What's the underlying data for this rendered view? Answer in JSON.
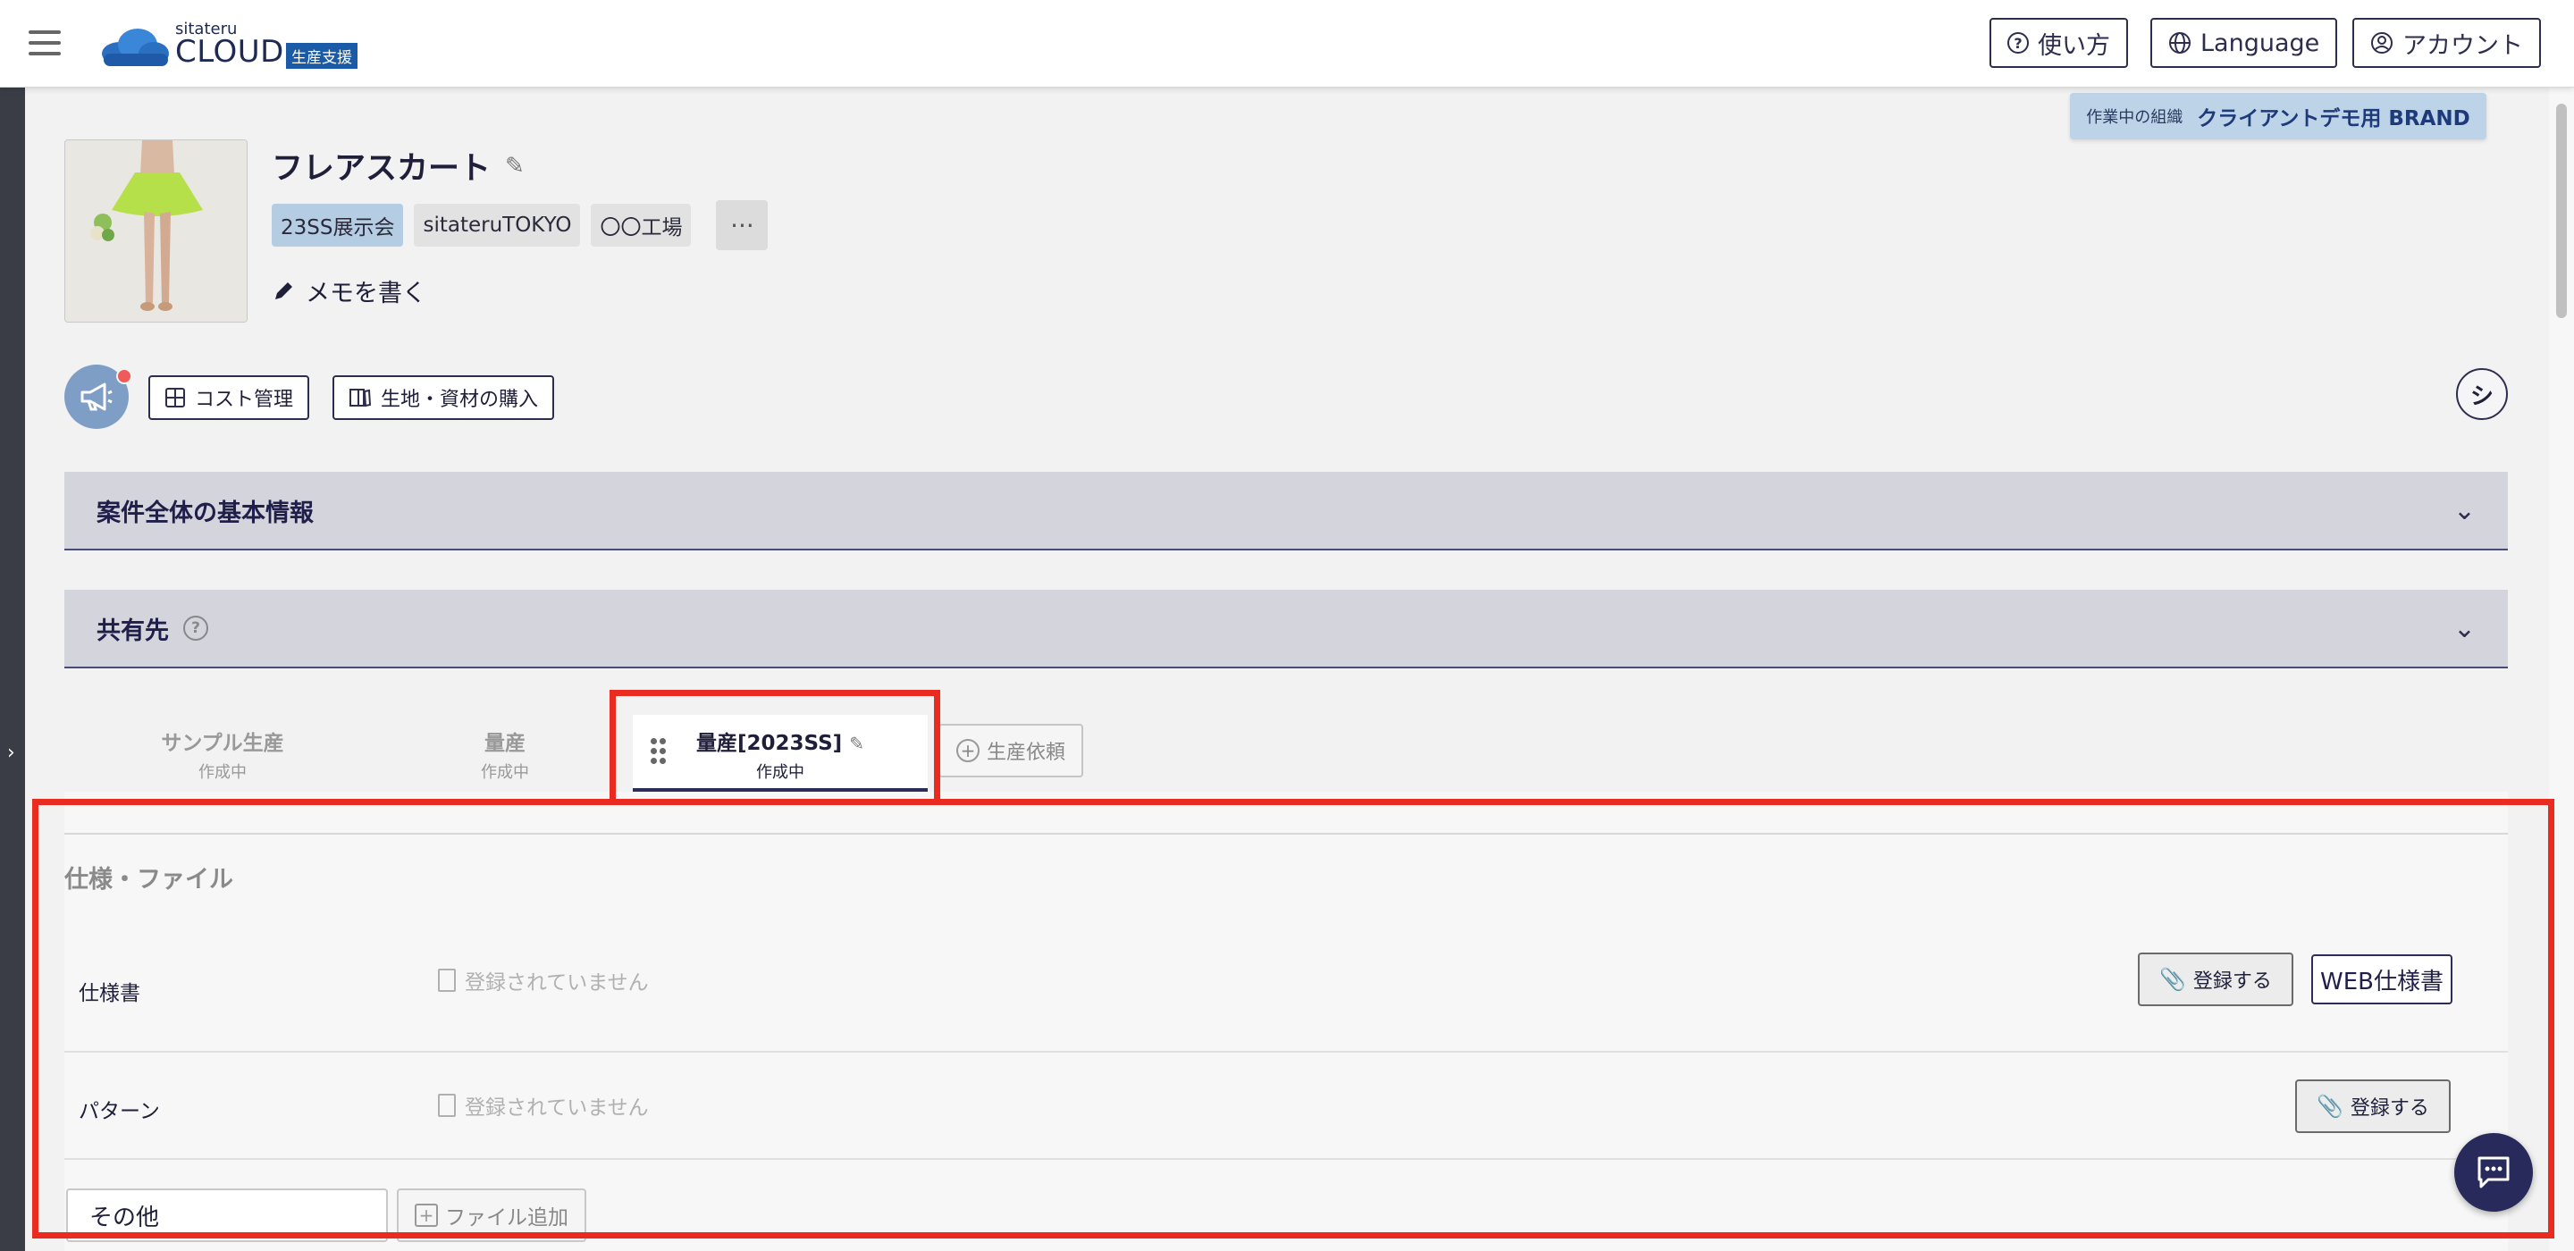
{
  "header": {
    "logo_small": "sitateru",
    "logo_main": "CLOUD",
    "logo_badge": "生産支援",
    "help_label": "使い方",
    "language_label": "Language",
    "account_label": "アカウント"
  },
  "org": {
    "label": "作業中の組織",
    "name": "クライアントデモ用 BRAND"
  },
  "product": {
    "title": "フレアスカート",
    "tags": [
      "23SS展示会",
      "sitateruTOKYO",
      "〇〇工場"
    ],
    "more_label": "···",
    "memo_label": "メモを書く"
  },
  "actions": {
    "cost_label": "コスト管理",
    "purchase_label": "生地・資材の購入",
    "circle_label": "シ"
  },
  "accordions": {
    "basic_info": "案件全体の基本情報",
    "share": "共有先"
  },
  "tabs": [
    {
      "name": "サンプル生産",
      "status": "作成中"
    },
    {
      "name": "量産",
      "status": "作成中"
    },
    {
      "name": "量産[2023SS]",
      "status": "作成中"
    }
  ],
  "add_tab_label": "生産依頼",
  "spec_section": {
    "title": "仕様・ファイル",
    "rows": [
      {
        "label": "仕様書",
        "empty": "登録されていません",
        "register": "登録する",
        "web": "WEB仕様書"
      },
      {
        "label": "パターン",
        "empty": "登録されていません",
        "register": "登録する"
      }
    ],
    "other_label": "その他",
    "add_file_label": "ファイル追加"
  },
  "colors": {
    "accent": "#2d2d5a",
    "highlight": "#ea2b1f",
    "org_banner": "#bcd3e8",
    "tag_blue": "#b4cde3"
  }
}
